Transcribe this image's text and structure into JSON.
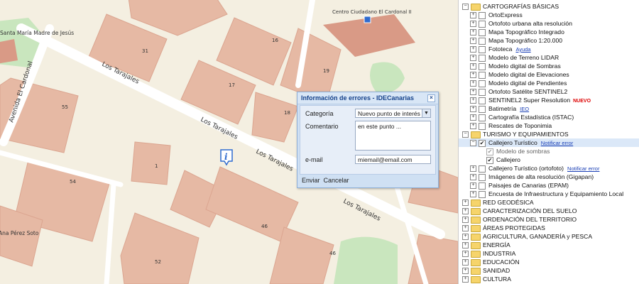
{
  "map": {
    "street_labels": [
      "Los Tarajales",
      "Los Tarajales",
      "Los Tarajales",
      "Los Tarajales",
      "Avenida El Cardonal"
    ],
    "place_labels": [
      "Santa María Madre de Jesús",
      "Centro Ciudadano El Cardonal II",
      "Ana Pérez Soto"
    ],
    "building_numbers": [
      "31",
      "16",
      "17",
      "19",
      "55",
      "18",
      "54",
      "1",
      "46",
      "52",
      "46"
    ],
    "info_icon": "i",
    "colors": {
      "background": "#f4efe1",
      "building": "#e6b9a4",
      "green": "#c9e6be",
      "road": "#ffffff",
      "poi": "#d99a86"
    }
  },
  "dialog": {
    "title": "Información de errores - IDECanarias",
    "close": "×",
    "category_label": "Categoría",
    "category_value": "Nuevo punto de interés",
    "comment_label": "Comentario",
    "comment_value": "en este punto ...",
    "email_label": "e-mail",
    "email_value": "miemail@email.com",
    "send": "Enviar",
    "cancel": "Cancelar"
  },
  "tree": [
    {
      "level": 0,
      "type": "folder",
      "expand": "−",
      "label": "CARTOGRAFÍAS BÁSICAS"
    },
    {
      "level": 1,
      "type": "layer",
      "expand": "+",
      "checked": false,
      "label": "OrtoExpress"
    },
    {
      "level": 1,
      "type": "layer",
      "expand": "+",
      "checked": false,
      "label": "Ortofoto urbana alta resolución"
    },
    {
      "level": 1,
      "type": "layer",
      "expand": "+",
      "checked": false,
      "label": "Mapa Topográfico Integrado"
    },
    {
      "level": 1,
      "type": "layer",
      "expand": "+",
      "checked": false,
      "label": "Mapa Topográfico 1:20.000"
    },
    {
      "level": 1,
      "type": "layer",
      "expand": "+",
      "checked": false,
      "label": "Fototeca",
      "link": "Ayuda"
    },
    {
      "level": 1,
      "type": "layer",
      "expand": "+",
      "checked": false,
      "label": "Modelo de Terreno LIDAR"
    },
    {
      "level": 1,
      "type": "layer",
      "expand": "+",
      "checked": false,
      "label": "Modelo digital de Sombras"
    },
    {
      "level": 1,
      "type": "layer",
      "expand": "+",
      "checked": false,
      "label": "Modelo digital de Elevaciones"
    },
    {
      "level": 1,
      "type": "layer",
      "expand": "+",
      "checked": false,
      "label": "Modelo digital de Pendientes"
    },
    {
      "level": 1,
      "type": "layer",
      "expand": "+",
      "checked": false,
      "label": "Ortofoto Satélite SENTINEL2"
    },
    {
      "level": 1,
      "type": "layer",
      "expand": "+",
      "checked": false,
      "label": "SENTINEL2 Super Resolution",
      "badge": "NUEVO"
    },
    {
      "level": 1,
      "type": "layer",
      "expand": "+",
      "checked": false,
      "label": "Batimetría",
      "link": "IEO"
    },
    {
      "level": 1,
      "type": "layer",
      "expand": "+",
      "checked": false,
      "label": "Cartografía Estadística (ISTAC)"
    },
    {
      "level": 1,
      "type": "layer",
      "expand": "+",
      "checked": false,
      "label": "Rescates de Toponimia"
    },
    {
      "level": 0,
      "type": "folder",
      "expand": "−",
      "label": "TURISMO Y EQUIPAMIENTOS"
    },
    {
      "level": 1,
      "type": "layer",
      "expand": "−",
      "checked": true,
      "label": "Callejero Turístico",
      "link": "Notificar error",
      "selected": true
    },
    {
      "level": 2,
      "type": "layer",
      "expand": "",
      "checked": true,
      "grey": true,
      "label": "Modelo de sombras"
    },
    {
      "level": 2,
      "type": "layer",
      "expand": "",
      "checked": true,
      "label": "Callejero"
    },
    {
      "level": 1,
      "type": "layer",
      "expand": "+",
      "checked": false,
      "label": "Callejero Turístico (ortofoto)",
      "link": "Notificar error"
    },
    {
      "level": 1,
      "type": "layer",
      "expand": "+",
      "checked": false,
      "label": "Imágenes de alta resolución (Gigapan)"
    },
    {
      "level": 1,
      "type": "layer",
      "expand": "+",
      "checked": false,
      "label": "Paisajes de Canarias (EPAM)"
    },
    {
      "level": 1,
      "type": "layer",
      "expand": "+",
      "checked": false,
      "label": "Encuesta de Infraestructura y Equipamiento Local"
    },
    {
      "level": 0,
      "type": "folder",
      "expand": "+",
      "label": "RED GEODÉSICA"
    },
    {
      "level": 0,
      "type": "folder",
      "expand": "+",
      "label": "CARACTERIZACIÓN DEL SUELO"
    },
    {
      "level": 0,
      "type": "folder",
      "expand": "+",
      "label": "ORDENACIÓN DEL TERRITORIO"
    },
    {
      "level": 0,
      "type": "folder",
      "expand": "+",
      "label": "ÁREAS PROTEGIDAS"
    },
    {
      "level": 0,
      "type": "folder",
      "expand": "+",
      "label": "AGRICULTURA, GANADERÍA y PESCA"
    },
    {
      "level": 0,
      "type": "folder",
      "expand": "+",
      "label": "ENERGÍA"
    },
    {
      "level": 0,
      "type": "folder",
      "expand": "+",
      "label": "INDUSTRIA"
    },
    {
      "level": 0,
      "type": "folder",
      "expand": "+",
      "label": "EDUCACIÓN"
    },
    {
      "level": 0,
      "type": "folder",
      "expand": "+",
      "label": "SANIDAD"
    },
    {
      "level": 0,
      "type": "folder",
      "expand": "+",
      "label": "CULTURA"
    }
  ]
}
